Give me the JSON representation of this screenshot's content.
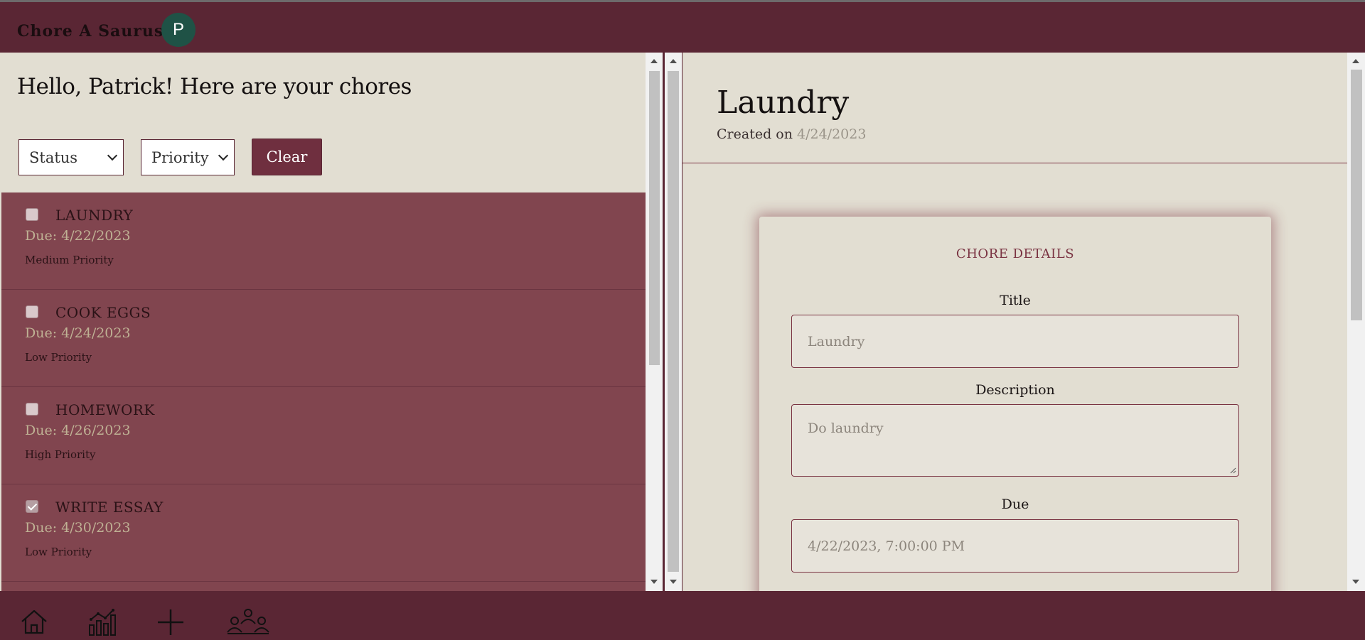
{
  "header": {
    "app_title": "Chore A Saurus",
    "avatar_initial": "P"
  },
  "left": {
    "greeting": "Hello, Patrick! Here are your chores",
    "filters": {
      "status_label": "Status",
      "priority_label": "Priority",
      "clear_label": "Clear"
    },
    "chores": [
      {
        "title": "LAUNDRY",
        "due": "Due: 4/22/2023",
        "priority": "Medium Priority",
        "done": false
      },
      {
        "title": "COOK EGGS",
        "due": "Due: 4/24/2023",
        "priority": "Low Priority",
        "done": false
      },
      {
        "title": "HOMEWORK",
        "due": "Due: 4/26/2023",
        "priority": "High Priority",
        "done": false
      },
      {
        "title": "WRITE ESSAY",
        "due": "Due: 4/30/2023",
        "priority": "Low Priority",
        "done": true
      }
    ]
  },
  "detail": {
    "title": "Laundry",
    "created_prefix": "Created on",
    "created_date": "4/24/2023",
    "card_heading": "CHORE DETAILS",
    "fields": {
      "title_label": "Title",
      "title_value": "Laundry",
      "description_label": "Description",
      "description_value": "Do laundry",
      "due_label": "Due",
      "due_value": "4/22/2023, 7:00:00 PM"
    }
  },
  "footer": {
    "nav": [
      "home-icon",
      "stats-icon",
      "add-icon",
      "group-icon"
    ]
  },
  "colors": {
    "brand": "#5a2634",
    "accent": "#7a3342",
    "list_bg": "#81454f",
    "pane_bg": "#e2ded2",
    "avatar_bg": "#1f5246"
  }
}
